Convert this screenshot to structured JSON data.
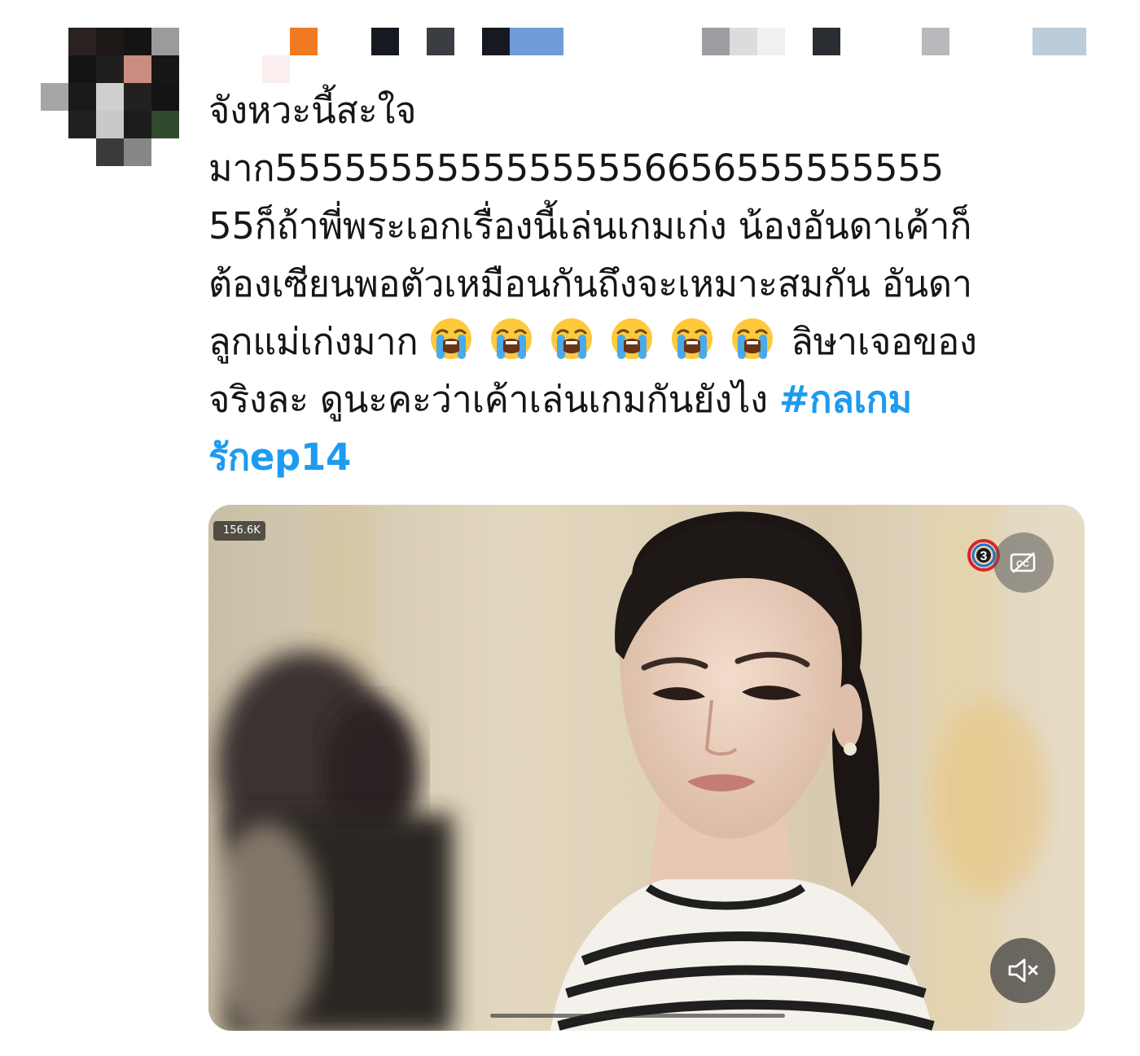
{
  "tweet": {
    "lines": [
      "จังหวะนี้สะใจ",
      "มาก55555555555555556656555555555",
      "55ก็ถ้าพี่พระเอกเรื่องนี้เล่นเกมเก่ง น้องอันดาเค้าก็",
      "ต้องเซียนพอตัวเหมือนกันถึงจะเหมาะสมกัน อันดา",
      "ลูกแม่เก่งมาก",
      "ลิษาเจอของ",
      "จริงละ ดูนะคะว่าเค้าเล่นเกมกันยังไง"
    ],
    "hashtag_part1": "#กลเกม",
    "hashtag_part2": "รักep14",
    "emoji_count": 6,
    "emoji_names": [
      "loudly-crying-face",
      "loudly-crying-face",
      "loudly-crying-face",
      "loudly-crying-face",
      "loudly-crying-face",
      "loudly-crying-face"
    ]
  },
  "media": {
    "view_count": "156.6K",
    "channel_logo": "channel-3-logo",
    "cc_icon": "closed-captions-icon",
    "mute_icon": "speaker-muted-icon"
  },
  "colors": {
    "text": "#14171a",
    "hashtag": "#1d9bf0",
    "background": "#ffffff"
  }
}
